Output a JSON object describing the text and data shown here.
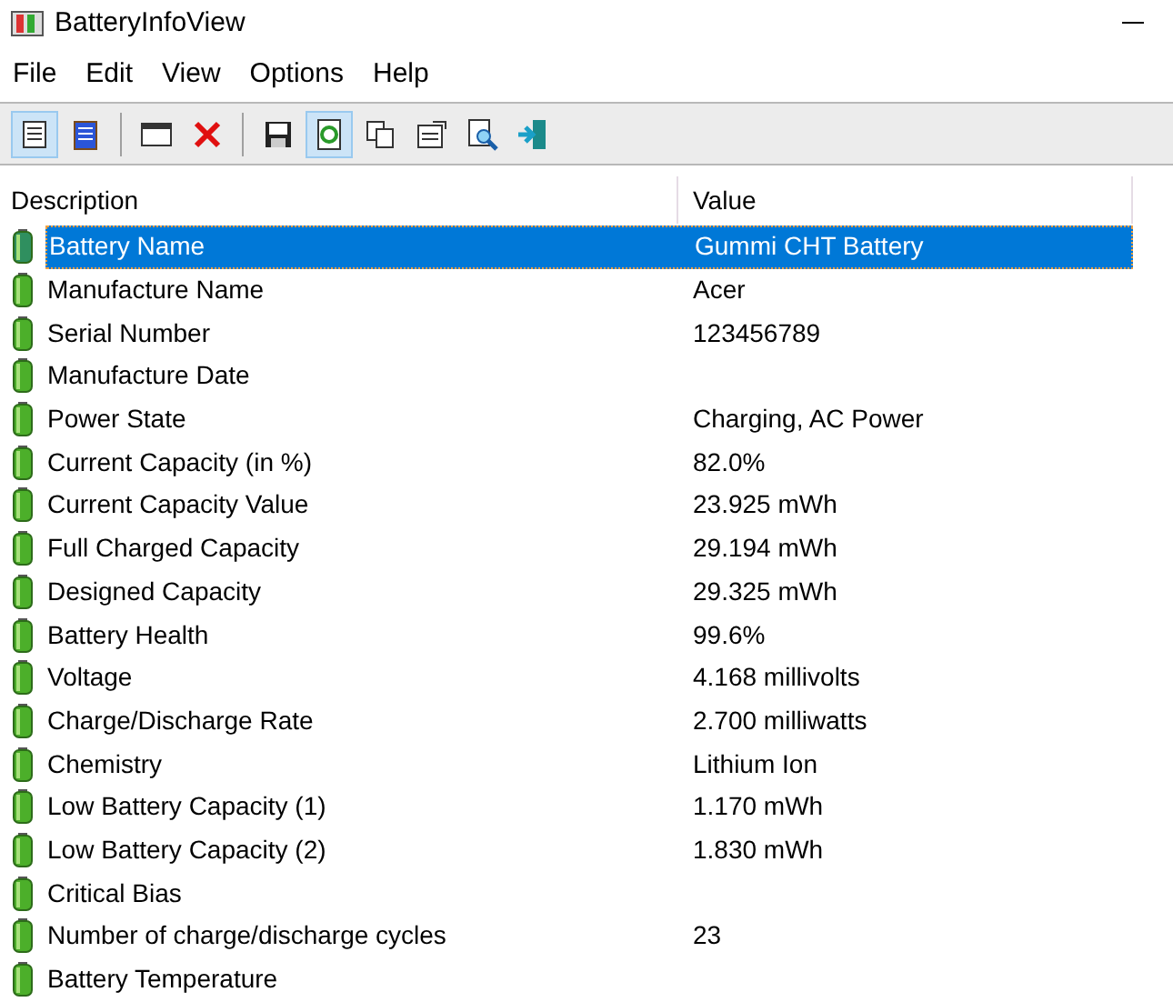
{
  "window": {
    "title": "BatteryInfoView"
  },
  "menu": [
    "File",
    "Edit",
    "View",
    "Options",
    "Help"
  ],
  "table": {
    "columns": [
      "Description",
      "Value"
    ],
    "rows": [
      {
        "description": "Battery Name",
        "value": "Gummi CHT Battery",
        "selected": true
      },
      {
        "description": "Manufacture Name",
        "value": "Acer",
        "selected": false
      },
      {
        "description": "Serial Number",
        "value": "123456789",
        "selected": false
      },
      {
        "description": "Manufacture Date",
        "selected": false
      },
      {
        "description": "Power State",
        "value": "Charging, AC Power",
        "selected": false
      },
      {
        "description": "Current Capacity (in %)",
        "value": "82.0%",
        "selected": false
      },
      {
        "description": "Current Capacity Value",
        "value": "23.925 mWh",
        "selected": false
      },
      {
        "description": "Full Charged Capacity",
        "value": "29.194 mWh",
        "selected": false
      },
      {
        "description": "Designed Capacity",
        "value": "29.325 mWh",
        "selected": false
      },
      {
        "description": "Battery Health",
        "value": "99.6%",
        "selected": false
      },
      {
        "description": "Voltage",
        "value": "4.168 millivolts",
        "selected": false
      },
      {
        "description": "Charge/Discharge Rate",
        "value": "2.700 milliwatts",
        "selected": false
      },
      {
        "description": "Chemistry",
        "value": "Lithium Ion",
        "selected": false
      },
      {
        "description": "Low Battery Capacity (1)",
        "value": "1.170 mWh",
        "selected": false
      },
      {
        "description": "Low Battery Capacity (2)",
        "value": "1.830 mWh",
        "selected": false
      },
      {
        "description": "Critical Bias",
        "selected": false
      },
      {
        "description": "Number of charge/discharge cycles",
        "value": "23",
        "selected": false
      },
      {
        "description": "Battery Temperature",
        "selected": false
      }
    ]
  }
}
